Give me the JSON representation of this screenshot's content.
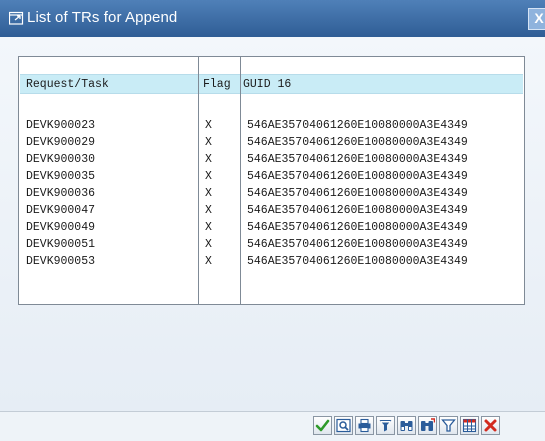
{
  "dialog": {
    "title": "List of TRs for Append",
    "close_label": "X"
  },
  "table": {
    "columns": [
      "Request/Task",
      "Flag",
      "GUID 16"
    ],
    "rows": [
      {
        "request": "DEVK900023",
        "flag": "X",
        "guid": "546AE35704061260E10080000A3E4349"
      },
      {
        "request": "DEVK900029",
        "flag": "X",
        "guid": "546AE35704061260E10080000A3E4349"
      },
      {
        "request": "DEVK900030",
        "flag": "X",
        "guid": "546AE35704061260E10080000A3E4349"
      },
      {
        "request": "DEVK900035",
        "flag": "X",
        "guid": "546AE35704061260E10080000A3E4349"
      },
      {
        "request": "DEVK900036",
        "flag": "X",
        "guid": "546AE35704061260E10080000A3E4349"
      },
      {
        "request": "DEVK900047",
        "flag": "X",
        "guid": "546AE35704061260E10080000A3E4349"
      },
      {
        "request": "DEVK900049",
        "flag": "X",
        "guid": "546AE35704061260E10080000A3E4349"
      },
      {
        "request": "DEVK900051",
        "flag": "X",
        "guid": "546AE35704061260E10080000A3E4349"
      },
      {
        "request": "DEVK900053",
        "flag": "X",
        "guid": "546AE35704061260E10080000A3E4349"
      }
    ]
  },
  "toolbar": {
    "buttons": [
      "continue-icon",
      "details-icon",
      "print-icon",
      "sort-icon",
      "find-icon",
      "find-next-icon",
      "filter-icon",
      "layout-icon",
      "cancel-icon"
    ]
  },
  "colors": {
    "title_bar": "#2f5d95",
    "header_bg": "#c9ecf6",
    "accent_check": "#2e9a2a",
    "cancel_red": "#d22a1f"
  }
}
